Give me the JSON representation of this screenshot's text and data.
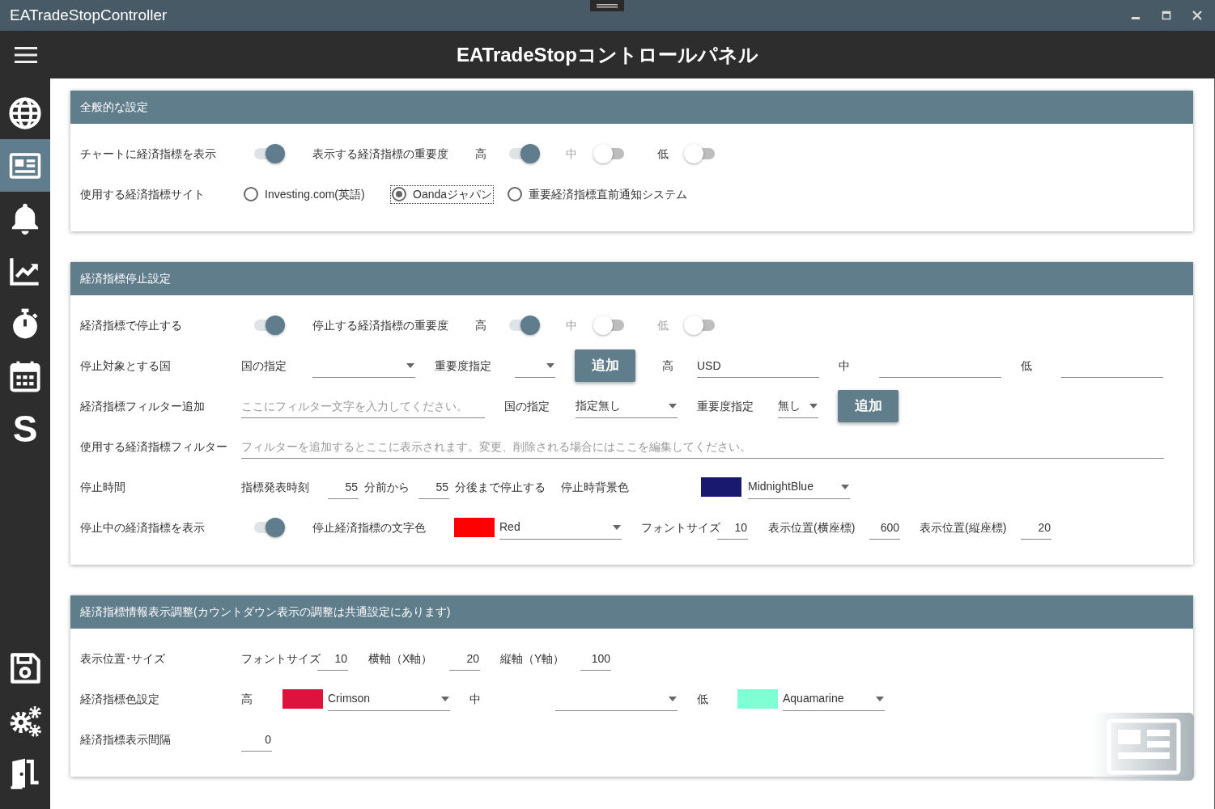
{
  "window": {
    "title": "EATradeStopController"
  },
  "header": {
    "title": "EATradeStopコントロールパネル"
  },
  "sidebar": {
    "items": [
      {
        "kind": "globe",
        "selected": false
      },
      {
        "kind": "newspaper",
        "selected": true
      },
      {
        "kind": "bell",
        "selected": false
      },
      {
        "kind": "chart",
        "selected": false
      },
      {
        "kind": "stopwatch",
        "selected": false
      },
      {
        "kind": "calendar",
        "selected": false
      },
      {
        "kind": "letter",
        "text": "S",
        "selected": false
      }
    ],
    "bottom_items": [
      {
        "kind": "save",
        "selected": false
      },
      {
        "kind": "gears",
        "selected": false
      },
      {
        "kind": "exit",
        "selected": false
      }
    ]
  },
  "sections": [
    {
      "title": "全般的な設定",
      "rows": [
        {
          "items": [
            {
              "kind": "label",
              "text": "チャートに経済指標を表示",
              "muted": false
            },
            {
              "kind": "toggle",
              "on": true
            },
            {
              "kind": "label",
              "text": "表示する経済指標の重要度",
              "muted": false
            },
            {
              "kind": "label",
              "text": "高",
              "muted": false
            },
            {
              "kind": "toggle",
              "on": true
            },
            {
              "kind": "label",
              "text": "中",
              "muted": true
            },
            {
              "kind": "toggle",
              "on": false
            },
            {
              "kind": "label",
              "text": "低",
              "muted": false
            },
            {
              "kind": "toggle",
              "on": false
            }
          ]
        },
        {
          "items": [
            {
              "kind": "label",
              "text": "使用する経済指標サイト",
              "muted": false
            },
            {
              "kind": "radio",
              "label": "Investing.com(英語)",
              "selected": false,
              "focused": false
            },
            {
              "kind": "radio",
              "label": "Oandaジャパン",
              "selected": true,
              "focused": true
            },
            {
              "kind": "radio",
              "label": "重要経済指標直前通知システム",
              "selected": false,
              "focused": false
            }
          ]
        }
      ]
    },
    {
      "title": "経済指標停止設定",
      "rows": [
        {
          "items": [
            {
              "kind": "label",
              "text": "経済指標で停止する",
              "muted": false
            },
            {
              "kind": "toggle",
              "on": true
            },
            {
              "kind": "label",
              "text": "停止する経済指標の重要度",
              "muted": false
            },
            {
              "kind": "label",
              "text": "高",
              "muted": false
            },
            {
              "kind": "toggle",
              "on": true
            },
            {
              "kind": "label",
              "text": "中",
              "muted": true
            },
            {
              "kind": "toggle",
              "on": false
            },
            {
              "kind": "label",
              "text": "低",
              "muted": true
            },
            {
              "kind": "toggle",
              "on": false
            }
          ]
        },
        {
          "items": [
            {
              "kind": "label",
              "text": "停止対象とする国",
              "muted": false
            },
            {
              "kind": "label",
              "text": "国の指定",
              "muted": false
            },
            {
              "kind": "dropdown"
            },
            {
              "kind": "label",
              "text": "重要度指定",
              "muted": false
            },
            {
              "kind": "dropdown"
            },
            {
              "kind": "button",
              "label": "追加"
            },
            {
              "kind": "label",
              "text": "高",
              "muted": false
            },
            {
              "kind": "field",
              "value": "USD"
            },
            {
              "kind": "label",
              "text": "中",
              "muted": false
            },
            {
              "kind": "field"
            },
            {
              "kind": "label",
              "text": "低",
              "muted": false
            },
            {
              "kind": "field"
            }
          ]
        },
        {
          "items": [
            {
              "kind": "label",
              "text": "経済指標フィルター追加",
              "muted": false
            },
            {
              "kind": "field",
              "placeholder": "ここにフィルター文字を入力してください。"
            },
            {
              "kind": "label",
              "text": "国の指定",
              "muted": false
            },
            {
              "kind": "dropdown",
              "value": "指定無し"
            },
            {
              "kind": "label",
              "text": "重要度指定",
              "muted": false
            },
            {
              "kind": "dropdown",
              "value": "無し"
            },
            {
              "kind": "button",
              "label": "追加"
            }
          ]
        },
        {
          "items": [
            {
              "kind": "label",
              "text": "使用する経済指標フィルター",
              "muted": false
            },
            {
              "kind": "field",
              "placeholder": "フィルターを追加するとここに表示されます。変更、削除される場合にはここを編集してください。"
            }
          ]
        },
        {
          "items": [
            {
              "kind": "label",
              "text": "停止時間",
              "muted": false
            },
            {
              "kind": "label",
              "text": "指標発表時刻",
              "muted": false
            },
            {
              "kind": "number",
              "value": "55"
            },
            {
              "kind": "label",
              "text": "分前から",
              "muted": false
            },
            {
              "kind": "number",
              "value": "55"
            },
            {
              "kind": "label",
              "text": "分後まで停止する",
              "muted": false
            },
            {
              "kind": "label",
              "text": "停止時背景色",
              "muted": false
            },
            {
              "kind": "swatch",
              "color": "#191970"
            },
            {
              "kind": "dropdown",
              "value": "MidnightBlue"
            }
          ]
        },
        {
          "items": [
            {
              "kind": "label",
              "text": "停止中の経済指標を表示",
              "muted": false
            },
            {
              "kind": "toggle",
              "on": true
            },
            {
              "kind": "label",
              "text": "停止経済指標の文字色",
              "muted": false
            },
            {
              "kind": "swatch",
              "color": "#ff0000"
            },
            {
              "kind": "dropdown",
              "value": "Red"
            },
            {
              "kind": "label",
              "text": "フォントサイズ",
              "muted": false
            },
            {
              "kind": "number",
              "value": "10"
            },
            {
              "kind": "label",
              "text": "表示位置(横座標)",
              "muted": false
            },
            {
              "kind": "number",
              "value": "600"
            },
            {
              "kind": "label",
              "text": "表示位置(縦座標)",
              "muted": false
            },
            {
              "kind": "number",
              "value": "20"
            }
          ]
        }
      ]
    },
    {
      "title": "経済指標情報表示調整(カウントダウン表示の調整は共通設定にあります)",
      "rows": [
        {
          "items": [
            {
              "kind": "label",
              "text": "表示位置･サイズ",
              "muted": false
            },
            {
              "kind": "label",
              "text": "フォントサイズ",
              "muted": false
            },
            {
              "kind": "number",
              "value": "10"
            },
            {
              "kind": "label",
              "text": "横軸（X軸）",
              "muted": false
            },
            {
              "kind": "number",
              "value": "20"
            },
            {
              "kind": "label",
              "text": "縦軸（Y軸）",
              "muted": false
            },
            {
              "kind": "number",
              "value": "100"
            }
          ]
        },
        {
          "items": [
            {
              "kind": "label",
              "text": "経済指標色設定",
              "muted": false
            },
            {
              "kind": "label",
              "text": "高",
              "muted": false
            },
            {
              "kind": "swatch",
              "color": "#dc143c"
            },
            {
              "kind": "dropdown",
              "value": "Crimson"
            },
            {
              "kind": "label",
              "text": "中",
              "muted": false
            },
            {
              "kind": "dropdown"
            },
            {
              "kind": "label",
              "text": "低",
              "muted": false
            },
            {
              "kind": "swatch",
              "color": "#7fffd4"
            },
            {
              "kind": "dropdown",
              "value": "Aquamarine"
            }
          ]
        },
        {
          "items": [
            {
              "kind": "label",
              "text": "経済指標表示間隔",
              "muted": false
            },
            {
              "kind": "number",
              "value": "0"
            }
          ]
        }
      ]
    }
  ]
}
